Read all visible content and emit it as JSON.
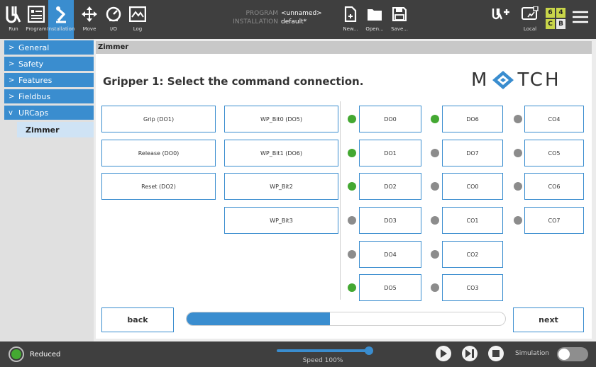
{
  "topbar": {
    "run_label": "Run",
    "program_label": "Program",
    "installation_label": "Installation",
    "move_label": "Move",
    "io_label": "I/O",
    "log_label": "Log",
    "program_key": "PROGRAM",
    "program_value": "<unnamed>",
    "installation_key": "INSTALLATION",
    "installation_value": "default*",
    "new_label": "New...",
    "open_label": "Open...",
    "save_label": "Save...",
    "local_label": "Local",
    "badge": [
      "6",
      "4",
      "C",
      "B"
    ]
  },
  "sidebar": {
    "items": [
      {
        "label": "General",
        "chevron": ">"
      },
      {
        "label": "Safety",
        "chevron": ">"
      },
      {
        "label": "Features",
        "chevron": ">"
      },
      {
        "label": "Fieldbus",
        "chevron": ">"
      },
      {
        "label": "URCaps",
        "chevron": "v"
      }
    ],
    "sub_item": "Zimmer"
  },
  "main": {
    "breadcrumb": "Zimmer",
    "heading": "Gripper 1: Select the command connection.",
    "logo_left": "M",
    "logo_right": "TCH",
    "commands": [
      "Grip (DO1)",
      "Release (DO0)",
      "Reset (DO2)"
    ],
    "bits": [
      "WP_Bit0 (DO5)",
      "WP_Bit1 (DO6)",
      "WP_Bit2",
      "WP_Bit3"
    ],
    "outputs_col1": [
      {
        "label": "DO0",
        "state": "on"
      },
      {
        "label": "DO1",
        "state": "on"
      },
      {
        "label": "DO2",
        "state": "on"
      },
      {
        "label": "DO3",
        "state": "off"
      },
      {
        "label": "DO4",
        "state": "off"
      },
      {
        "label": "DO5",
        "state": "on"
      }
    ],
    "outputs_col2": [
      {
        "label": "DO6",
        "state": "on"
      },
      {
        "label": "DO7",
        "state": "off"
      },
      {
        "label": "CO0",
        "state": "off"
      },
      {
        "label": "CO1",
        "state": "off"
      },
      {
        "label": "CO2",
        "state": "off"
      },
      {
        "label": "CO3",
        "state": "off"
      }
    ],
    "outputs_col3": [
      {
        "label": "CO4",
        "state": "off"
      },
      {
        "label": "CO5",
        "state": "off"
      },
      {
        "label": "CO6",
        "state": "off"
      },
      {
        "label": "CO7",
        "state": "off"
      }
    ],
    "back_label": "back",
    "next_label": "next",
    "progress": 0.45
  },
  "bottombar": {
    "mode": "Reduced",
    "speed": "Speed 100%",
    "simulation": "Simulation"
  },
  "colors": {
    "accent": "#3a8dcf",
    "on": "#44a832",
    "off": "#8c8c8c",
    "bar": "#3f3f3f"
  }
}
